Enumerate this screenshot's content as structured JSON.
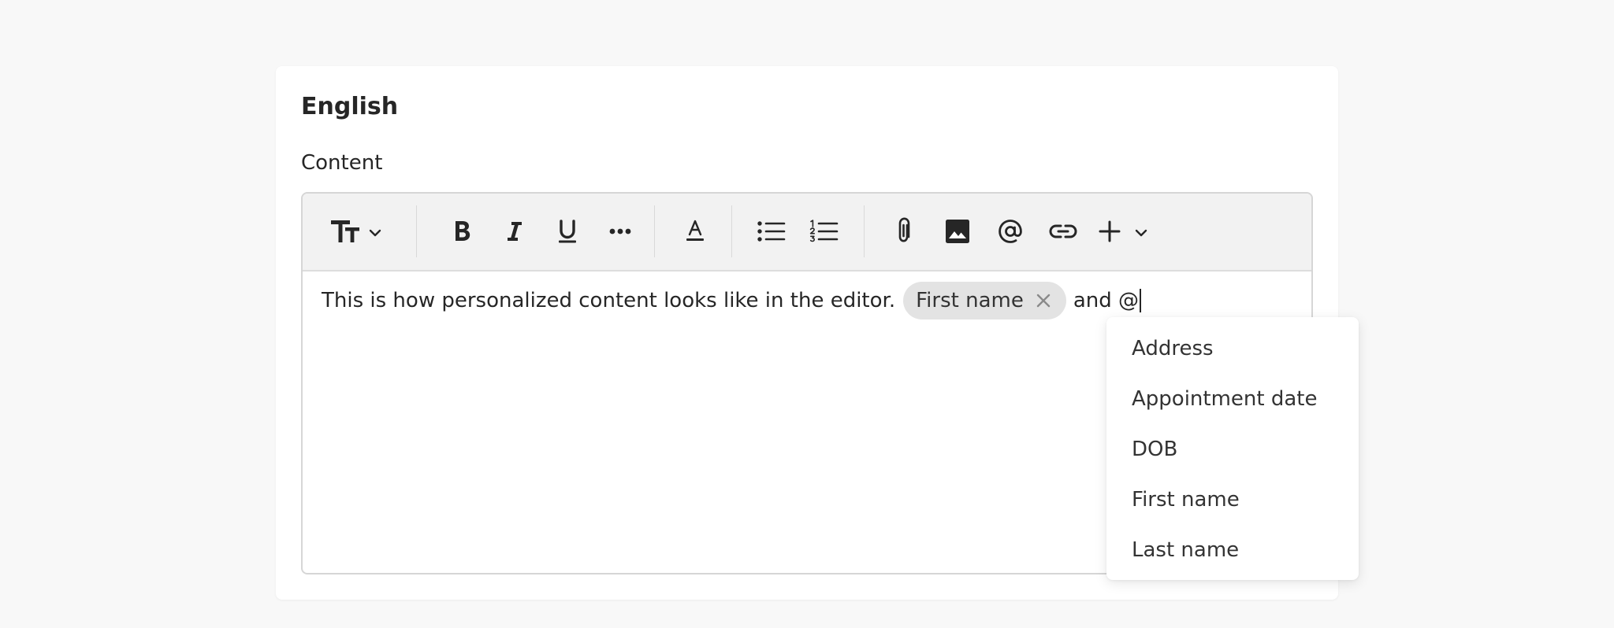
{
  "card": {
    "title": "English",
    "field_label": "Content"
  },
  "toolbar": {
    "items": [
      {
        "icon": "text-size-icon",
        "label": "Text size",
        "dropdown": true
      },
      {
        "icon": "bold-icon",
        "label": "Bold"
      },
      {
        "icon": "italic-icon",
        "label": "Italic"
      },
      {
        "icon": "underline-icon",
        "label": "Underline"
      },
      {
        "icon": "more-horizontal-icon",
        "label": "More formatting"
      },
      {
        "icon": "text-color-icon",
        "label": "Text color"
      },
      {
        "icon": "bulleted-list-icon",
        "label": "Bulleted list"
      },
      {
        "icon": "numbered-list-icon",
        "label": "Numbered list"
      },
      {
        "icon": "paperclip-icon",
        "label": "Attach file"
      },
      {
        "icon": "image-icon",
        "label": "Insert image"
      },
      {
        "icon": "at-sign-icon",
        "label": "Mention"
      },
      {
        "icon": "link-icon",
        "label": "Insert link"
      },
      {
        "icon": "plus-icon",
        "label": "Insert",
        "dropdown": true
      }
    ]
  },
  "editor": {
    "text_before": "This is how personalized content looks like in the editor.",
    "chip_label": "First name",
    "text_after": "and @"
  },
  "mention_dropdown": {
    "options": [
      "Address",
      "Appointment date",
      "DOB",
      "First name",
      "Last name"
    ]
  }
}
